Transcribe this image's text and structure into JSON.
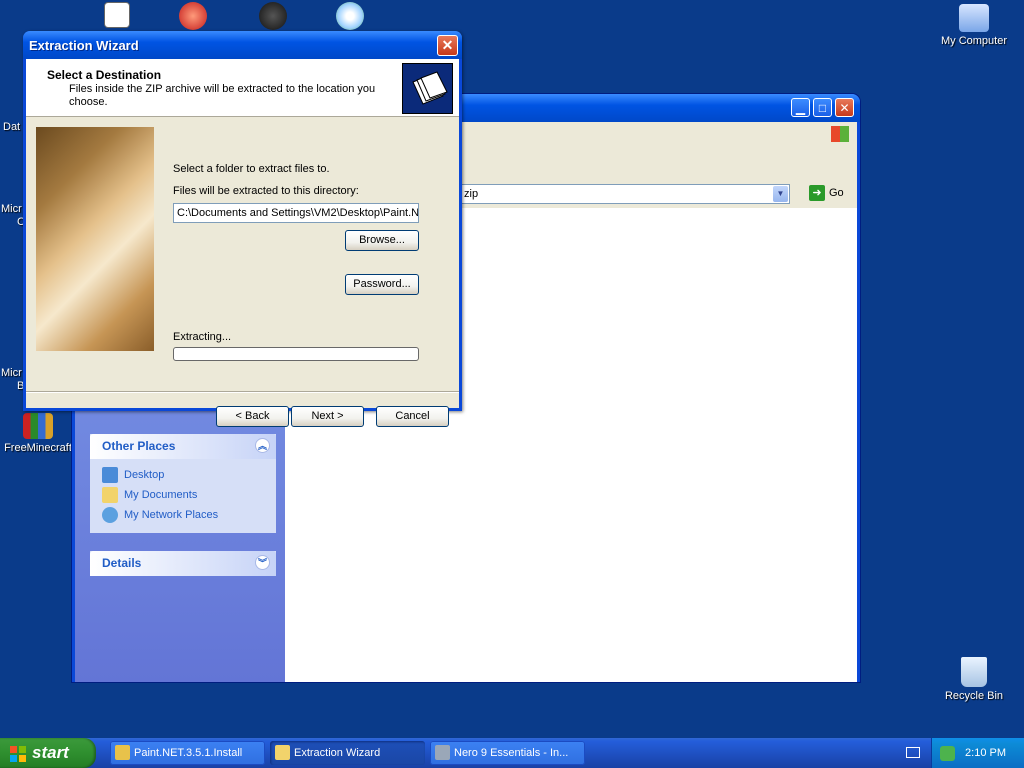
{
  "desktop": {
    "icons": [
      {
        "label": "My Computer",
        "icon": "my-computer-icon"
      },
      {
        "label": "FreeMinecraft",
        "icon": "minecraft-package-icon"
      },
      {
        "label": "Recycle Bin",
        "icon": "recycle-bin-icon"
      }
    ],
    "partial_labels": [
      "Dat",
      "Micr",
      "C",
      "Micr",
      "B"
    ]
  },
  "explorer": {
    "address_text": "zip",
    "go_label": "Go",
    "other_places": {
      "title": "Other Places",
      "items": [
        "Desktop",
        "My Documents",
        "My Network Places"
      ]
    },
    "details": {
      "title": "Details"
    }
  },
  "wizard": {
    "title": "Extraction Wizard",
    "header_title": "Select a Destination",
    "header_subtitle": "Files inside the ZIP archive will be extracted to the location you choose.",
    "select_folder_label": "Select a folder to extract files to.",
    "directory_label": "Files will be extracted to this directory:",
    "directory_value": "C:\\Documents and Settings\\VM2\\Desktop\\Paint.N",
    "browse_label": "Browse...",
    "password_label": "Password...",
    "extracting_label": "Extracting...",
    "progress": 0,
    "back_label": "< Back",
    "next_label": "Next >",
    "cancel_label": "Cancel"
  },
  "taskbar": {
    "start_label": "start",
    "tasks": [
      {
        "label": "Paint.NET.3.5.1.Install",
        "active": false
      },
      {
        "label": "Extraction Wizard",
        "active": true
      },
      {
        "label": "Nero 9 Essentials - In...",
        "active": false
      }
    ],
    "clock": "2:10 PM"
  },
  "colors": {
    "desktop": "#0a3b8a",
    "title_bar": "#0054e3",
    "taskbar": "#245edb",
    "start_button": "#2f8f2f"
  }
}
